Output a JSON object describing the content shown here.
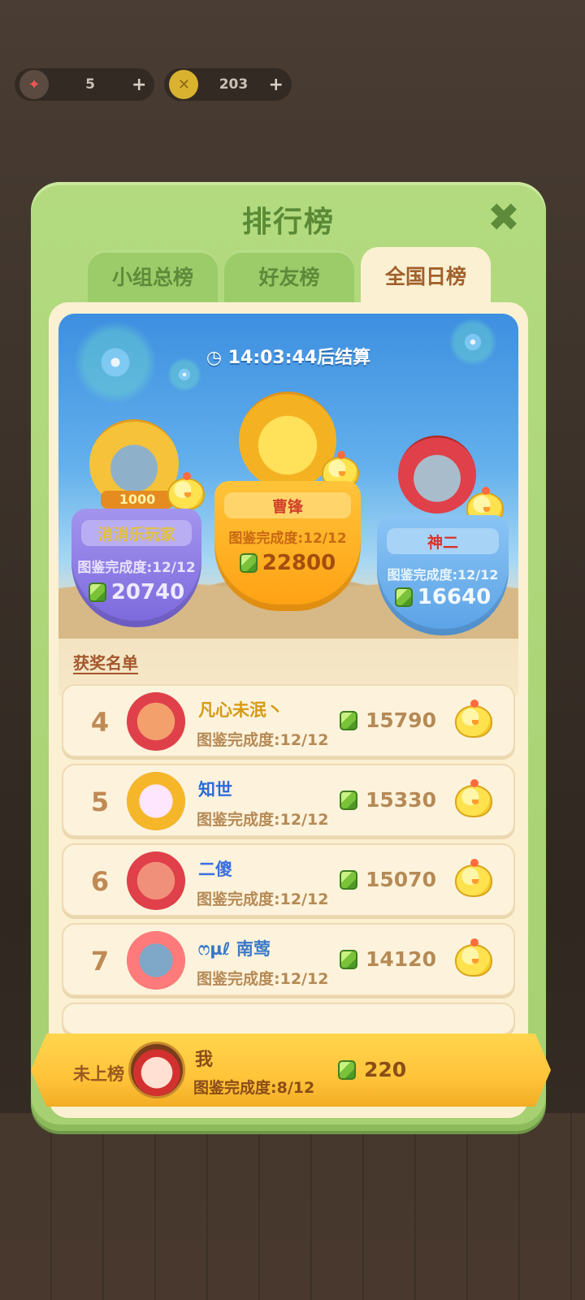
{
  "topbar": {
    "left_count": "5",
    "coins": "203",
    "plus_label": "+"
  },
  "modal": {
    "title": "排行榜",
    "close_label": "✖"
  },
  "tabs": [
    {
      "label": "小组总榜",
      "active": false
    },
    {
      "label": "好友榜",
      "active": false
    },
    {
      "label": "全国日榜",
      "active": true
    }
  ],
  "timer": {
    "time": "14:03:44",
    "suffix": "后结算"
  },
  "podium": {
    "first": {
      "name": "曹锋",
      "progress": "图鉴完成度:12/12",
      "score": "22800"
    },
    "second": {
      "name": "消消乐玩家",
      "progress": "图鉴完成度:12/12",
      "score": "20740",
      "badge": "1000"
    },
    "third": {
      "name": "神二",
      "progress": "图鉴完成度:12/12",
      "score": "16640"
    }
  },
  "section_title": "获奖名单",
  "ranking": [
    {
      "rank": "4",
      "name": "凡心未泯丶",
      "progress": "图鉴完成度:12/12",
      "score": "15790"
    },
    {
      "rank": "5",
      "name": "知世",
      "progress": "图鉴完成度:12/12",
      "score": "15330"
    },
    {
      "rank": "6",
      "name": "二傻",
      "progress": "图鉴完成度:12/12",
      "score": "15070"
    },
    {
      "rank": "7",
      "name": "ෆµℓ 南莺",
      "progress": "图鉴完成度:12/12",
      "score": "14120"
    }
  ],
  "me": {
    "status": "未上榜",
    "name": "我",
    "progress": "图鉴完成度:8/12",
    "score": "220"
  },
  "colors": {
    "modal_green": "#a6d072",
    "panel_cream": "#fbf0d2",
    "gold": "#ffc43a",
    "purple": "#8f7be8",
    "orange": "#ffae22",
    "blue": "#6bb0ef"
  }
}
